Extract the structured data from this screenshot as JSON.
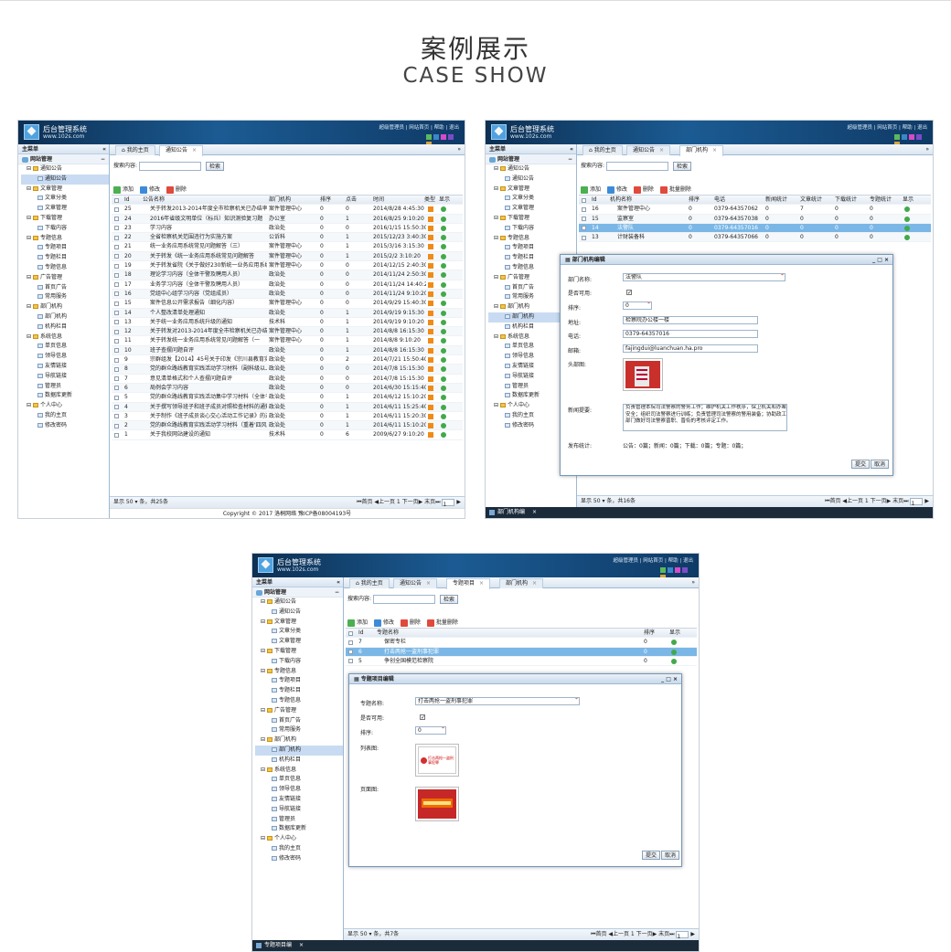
{
  "heading": {
    "cn": "案例展示",
    "en": "CASE SHOW"
  },
  "app": {
    "name": "后台管理系统",
    "url": "www.102s.com",
    "links": "超级管理员 | 网站首页 | 帮助 | 退出",
    "swatches": [
      "#5cb85c",
      "#3a87c9",
      "#d84ac8",
      "#7b4cc7",
      "#d8a43a"
    ]
  },
  "sidebar": {
    "title": "主菜单",
    "collapse": "«",
    "section": "网站管理",
    "section_toggle": "−",
    "groups": [
      {
        "label": "通知公告",
        "items": [
          "通知公告"
        ]
      },
      {
        "label": "文章管理",
        "items": [
          "文章分类",
          "文章管理"
        ]
      },
      {
        "label": "下载管理",
        "items": [
          "下载内容"
        ]
      },
      {
        "label": "专题信息",
        "items": [
          "专题项目",
          "专题栏目",
          "专题信息"
        ]
      },
      {
        "label": "广告管理",
        "items": [
          "首页广告",
          "常用服务"
        ]
      },
      {
        "label": "部门机构",
        "items": [
          "部门机构",
          "机构栏目"
        ]
      },
      {
        "label": "系统信息",
        "items": [
          "单页信息",
          "领导信息",
          "友情链接",
          "导航链接",
          "管理员",
          "数据库更新"
        ]
      },
      {
        "label": "个人中心",
        "items": [
          "我的主页",
          "修改密码"
        ]
      }
    ]
  },
  "s1": {
    "tabs": [
      "我的主页",
      "通知公告"
    ],
    "search_label": "搜索内容:",
    "search_btn": "检索",
    "toolbar": [
      "添加",
      "修改",
      "删除"
    ],
    "headers": [
      "Id",
      "公告名称",
      "部门机构",
      "排序",
      "点击",
      "时间",
      "类型",
      "显示"
    ],
    "rows": [
      [
        "25",
        "关于转发2013-2014年度全市检察机关已办结率",
        "案件管理中心",
        "0",
        "0",
        "2014/8/28 4:45:30"
      ],
      [
        "24",
        "2016年省级文明单位（标兵）知识测验复习题",
        "办公室",
        "0",
        "1",
        "2016/8/25 9:10:20"
      ],
      [
        "23",
        "学习内容",
        "政治处",
        "0",
        "0",
        "2016/1/15 15:50:30"
      ],
      [
        "22",
        "全省检察机关范围违行为实施方案",
        "公诉科",
        "0",
        "1",
        "2015/12/23 3:40:30"
      ],
      [
        "21",
        "统一业务应用系统常见问题解答（三）",
        "案件管理中心",
        "0",
        "1",
        "2015/3/16 3:15:30"
      ],
      [
        "20",
        "关于转发《统一业务应用系统常见问题解答",
        "案件管理中心",
        "0",
        "1",
        "2015/2/2 3:10:20"
      ],
      [
        "19",
        "关于转发省院《关于做好230新统一业务应用系统",
        "案件管理中心",
        "0",
        "0",
        "2014/12/15 2:40:30"
      ],
      [
        "18",
        "理论学习内容（全体干警及聘用人员）",
        "政治处",
        "0",
        "0",
        "2014/11/24 2:50:30"
      ],
      [
        "17",
        "业务学习内容（全体干警及聘用人员）",
        "政治处",
        "0",
        "0",
        "2014/11/24 14:40:2"
      ],
      [
        "16",
        "党组中心组学习内容（党组成员）",
        "政治处",
        "0",
        "0",
        "2014/11/24 9:10:20"
      ],
      [
        "15",
        "案件信息公开需求报告（细化内容）",
        "案件管理中心",
        "0",
        "0",
        "2014/9/29 15:40:30"
      ],
      [
        "14",
        "个人整改清单处理通知",
        "政治处",
        "0",
        "1",
        "2014/9/19 9:15:30"
      ],
      [
        "13",
        "关于统一业务应用系统升级的通知",
        "技术科",
        "0",
        "1",
        "2014/9/19 9:10:20"
      ],
      [
        "12",
        "关于转发对2013-2014年度全市检察机关已办结率",
        "案件管理中心",
        "0",
        "1",
        "2014/8/8 16:15:30"
      ],
      [
        "11",
        "关于转发统一业务应用系统常见问题解答（一",
        "案件管理中心",
        "0",
        "1",
        "2014/8/8 9:10:20"
      ],
      [
        "10",
        "班子查摆问题自评",
        "政治处",
        "0",
        "1",
        "2014/8/8 16:15:30"
      ],
      [
        "9",
        "宗群组发【2014】45号关于印发《宗川县教育实",
        "政治处",
        "0",
        "2",
        "2014/7/21 15:50:40"
      ],
      [
        "8",
        "党的群众路线教育实践活动学习材料（副科级以上",
        "政治处",
        "0",
        "0",
        "2014/7/8 15:15:30"
      ],
      [
        "7",
        "意见清单格式和个人查摆问题自评",
        "政治处",
        "0",
        "0",
        "2014/7/8 15:15:30"
      ],
      [
        "6",
        "局例会学习内容",
        "政治处",
        "0",
        "0",
        "2014/6/30 15:15:40"
      ],
      [
        "5",
        "党的群众路线教育实践活动集中学习材料（全体干",
        "政治处",
        "0",
        "1",
        "2014/6/12 15:10:20"
      ],
      [
        "4",
        "关于撰写领导班子和班子成员对照检查材料的通知",
        "政治处",
        "0",
        "1",
        "2014/6/11 15:25:40"
      ],
      [
        "3",
        "关于制作《班子成员谈心交心活动工作记录》的通",
        "政治处",
        "0",
        "1",
        "2014/6/11 15:20:30"
      ],
      [
        "2",
        "党的群众路线教育实践活动学习材料（重着'四风'",
        "政治处",
        "0",
        "1",
        "2014/6/11 15:10:20"
      ],
      [
        "1",
        "关于我校网站建设的通知",
        "技术科",
        "0",
        "6",
        "2009/6/27 9:10:20"
      ]
    ],
    "footer": "显示 50 ▾ 条，共25条",
    "pager": "⏮首页  ◀上一页  1  下一页▶  末页⏭",
    "page": "1",
    "copyright": "Copyright © 2017 洛桐网络 豫ICP备08004193号"
  },
  "s2": {
    "tabs": [
      "我的主页",
      "通知公告",
      "部门机构"
    ],
    "search_label": "搜索内容:",
    "search_btn": "检索",
    "toolbar": [
      "添加",
      "修改",
      "删除",
      "批量删除"
    ],
    "headers": [
      "Id",
      "机构名称",
      "排序",
      "电话",
      "新闻统计",
      "文章统计",
      "下载统计",
      "专题统计",
      "显示"
    ],
    "rows": [
      [
        "16",
        "案件管理中心",
        "0",
        "0379-64357062",
        "0",
        "7",
        "0",
        "0"
      ],
      [
        "15",
        "监察室",
        "0",
        "0379-64357038",
        "0",
        "0",
        "0",
        "0"
      ],
      [
        "14",
        "法警队",
        "0",
        "0379-64357016",
        "0",
        "0",
        "0",
        "0"
      ],
      [
        "13",
        "计财装备科",
        "0",
        "0379-64357066",
        "0",
        "0",
        "0",
        "0"
      ]
    ],
    "dialog": {
      "title": "部门机构编辑",
      "name_label": "部门名称:",
      "name": "法警队",
      "avail_label": "是否可用:",
      "sort_label": "排序:",
      "sort": "0",
      "addr_label": "地址:",
      "addr": "检察院办公楼一楼",
      "tel_label": "电话:",
      "tel": "0379-64357016",
      "mail_label": "邮箱:",
      "mail": "fajingdui@luanchuan.ha.pro",
      "photo_label": "头部图:",
      "desc_label": "新闻提要:",
      "desc": "负责管理本院司法警察的警务工作；维护机关工作秩序，保卫机关和办案安全；组织司法警察进行训练；负责管理司法警察的警用装备；协助政工部门做好司法警察晋职、晋衔的考核评定工作。",
      "stats_label": "发布统计:",
      "stats": "公告：0篇；新闻：0篇；下载：0篇；专题：0篇；",
      "submit": "提交",
      "cancel": "取消",
      "ctl": "_ □ ×"
    },
    "footer": "显示 50 ▾ 条，共16条",
    "pager": "⏮首页  ◀上一页  1  下一页▶  末页⏭",
    "page": "1",
    "task": "部门机构编"
  },
  "s3": {
    "tabs": [
      "我的主页",
      "通知公告",
      "专题项目",
      "部门机构"
    ],
    "search_label": "搜索内容:",
    "search_btn": "检索",
    "toolbar": [
      "添加",
      "修改",
      "删除",
      "批量删除"
    ],
    "headers": [
      "Id",
      "专题名称",
      "排序",
      "显示"
    ],
    "rows": [
      [
        "7",
        "保密专栏",
        "0"
      ],
      [
        "6",
        "打击两抢一盗刑事犯罪",
        "0"
      ],
      [
        "5",
        "争创全国模范检察院",
        "0"
      ]
    ],
    "dialog": {
      "title": "专题项目编辑",
      "name_label": "专题名称:",
      "name": "打击两抢一盗刑事犯罪",
      "avail_label": "是否可用:",
      "sort_label": "排序:",
      "sort": "0",
      "list_label": "列表图:",
      "page_label": "页面图:",
      "list_img_text": "打击两抢一盗刑事犯罪",
      "submit": "提交",
      "cancel": "取消",
      "ctl": "_ □ ×"
    },
    "footer": "显示 50 ▾ 条，共7条",
    "pager": "⏮首页  ◀上一页  1  下一页▶  末页⏭",
    "page": "1",
    "task": "专题项目编"
  }
}
